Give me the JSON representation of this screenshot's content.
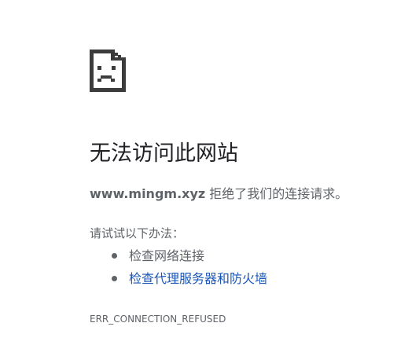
{
  "error_page": {
    "icon": "sad-page-icon",
    "title": "无法访问此网站",
    "host": "www.mingm.xyz",
    "message_suffix": " 拒绝了我们的连接请求。",
    "suggestions_heading": "请试试以下办法：",
    "suggestions": [
      {
        "label": "检查网络连接",
        "is_link": false
      },
      {
        "label": "检查代理服务器和防火墙",
        "is_link": true
      }
    ],
    "error_code": "ERR_CONNECTION_REFUSED"
  },
  "colors": {
    "text": "#5f6368",
    "title": "#202124",
    "link": "#1a56b8",
    "icon": "#3c3c3c"
  }
}
